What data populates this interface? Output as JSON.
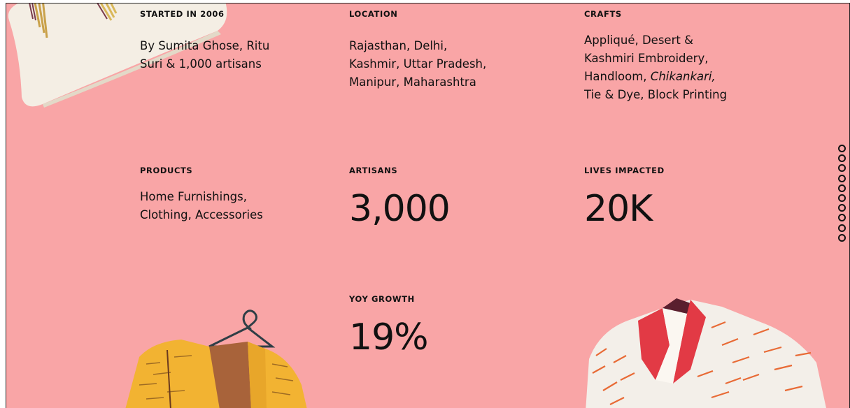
{
  "stats": {
    "started": {
      "label": "STARTED IN 2006",
      "line1": "By Sumita Ghose, Ritu",
      "line2": "Suri & 1,000 artisans"
    },
    "location": {
      "label": "LOCATION",
      "line1": "Rajasthan, Delhi,",
      "line2": "Kashmir, Uttar Pradesh,",
      "line3": "Manipur, Maharashtra"
    },
    "crafts": {
      "label": "CRAFTS",
      "line1": "Appliqué, Desert &",
      "line2": "Kashmiri Embroidery,",
      "line3_prefix": "Handloom, ",
      "line3_italic": "Chikankari,",
      "line4": "Tie & Dye, Block Printing"
    },
    "products": {
      "label": "PRODUCTS",
      "line1": "Home Furnishings,",
      "line2": "Clothing, Accessories"
    },
    "artisans": {
      "label": "ARTISANS",
      "value": "3,000"
    },
    "lives": {
      "label": "LIVES IMPACTED",
      "value": "20K"
    },
    "growth": {
      "label": "YOY GROWTH",
      "value": "19%"
    }
  },
  "nav_dots": {
    "count": 10,
    "icon": "hollow-circle-icon"
  },
  "colors": {
    "background": "#f9a5a6",
    "text": "#111111",
    "cushion": "#f4eee4",
    "garment_yellow": "#f2b332",
    "garment_brown": "#a8633a",
    "kurta_white": "#f3efe9",
    "kurta_red": "#e23a45",
    "kurta_orange": "#e86a35"
  }
}
